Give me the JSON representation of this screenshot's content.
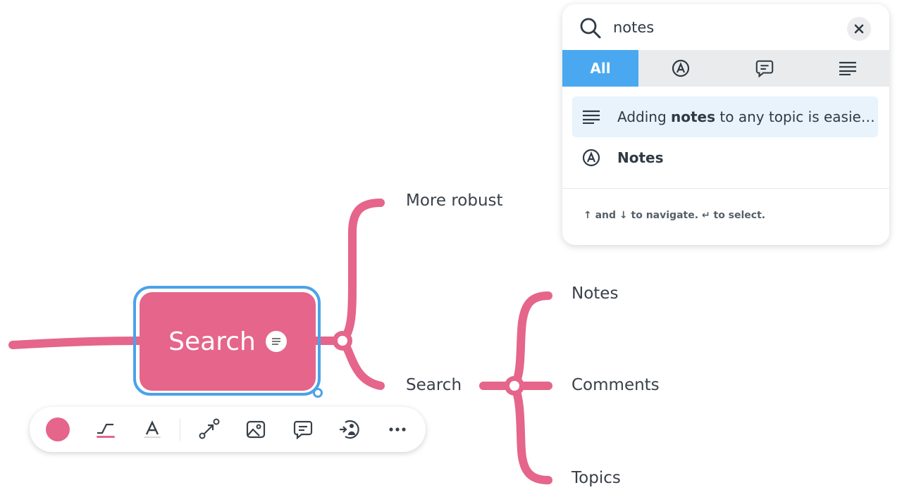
{
  "colors": {
    "branch": "#e5658b",
    "selection": "#4aa3e8",
    "tab_active": "#4aa8f0",
    "result_highlight": "#e8f3fb"
  },
  "mindmap": {
    "central_topic": "Search",
    "branch_labels": {
      "more_robust": "More robust",
      "search": "Search",
      "notes": "Notes",
      "comments": "Comments",
      "topics": "Topics"
    }
  },
  "toolbar": {
    "items": [
      {
        "name": "color-swatch",
        "icon": "filled-circle"
      },
      {
        "name": "line-style",
        "icon": "line-style-icon"
      },
      {
        "name": "text-style",
        "icon": "text-style-icon"
      },
      {
        "name": "connect",
        "icon": "relation-arrow-icon"
      },
      {
        "name": "image",
        "icon": "image-icon"
      },
      {
        "name": "comment",
        "icon": "comment-icon"
      },
      {
        "name": "assign",
        "icon": "assign-user-icon"
      },
      {
        "name": "more",
        "icon": "ellipsis-icon"
      }
    ]
  },
  "search": {
    "query": "notes",
    "tabs": {
      "all": "All",
      "topics_icon": "topic-a-icon",
      "comments_icon": "comment-icon",
      "notes_icon": "notes-lines-icon"
    },
    "results": [
      {
        "type": "note",
        "prefix": "Adding ",
        "match": "notes",
        "suffix": " to any topic is easie…"
      },
      {
        "type": "topic",
        "prefix": "",
        "match": "Notes",
        "suffix": ""
      }
    ],
    "hint": "↑ and ↓ to navigate. ↵ to select."
  }
}
